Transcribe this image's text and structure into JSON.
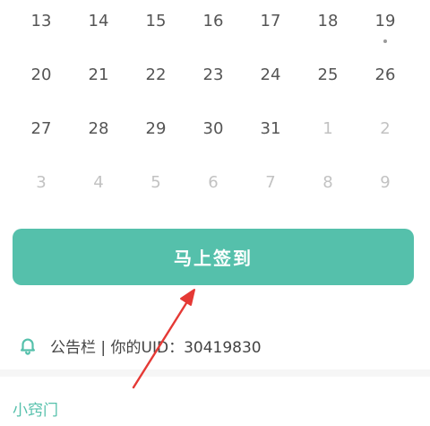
{
  "calendar": {
    "rows": [
      [
        {
          "label": "13"
        },
        {
          "label": "14"
        },
        {
          "label": "15"
        },
        {
          "label": "16"
        },
        {
          "label": "17"
        },
        {
          "label": "18"
        },
        {
          "label": "19"
        }
      ],
      [
        {
          "label": "20"
        },
        {
          "label": "21"
        },
        {
          "label": "22"
        },
        {
          "label": "23"
        },
        {
          "label": "24"
        },
        {
          "label": "25"
        },
        {
          "label": "26"
        }
      ],
      [
        {
          "label": "27"
        },
        {
          "label": "28"
        },
        {
          "label": "29"
        },
        {
          "label": "30"
        },
        {
          "label": "31"
        },
        {
          "label": "1"
        },
        {
          "label": "2"
        }
      ],
      [
        {
          "label": "3"
        },
        {
          "label": "4"
        },
        {
          "label": "5"
        },
        {
          "label": "6"
        },
        {
          "label": "7"
        },
        {
          "label": "8"
        },
        {
          "label": "9"
        }
      ]
    ]
  },
  "signin": {
    "label": "马上签到"
  },
  "notice": {
    "icon": "bell-icon",
    "text": "公告栏 | 你的UID：30419830"
  },
  "section": {
    "title": "小窍门"
  },
  "colors": {
    "accent": "#55c0ab",
    "annotation": "#e53935"
  }
}
